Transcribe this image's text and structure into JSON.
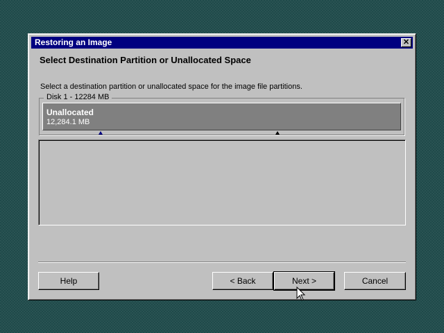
{
  "dialog": {
    "title": "Restoring an Image",
    "close_glyph": "✕",
    "heading": "Select Destination Partition or Unallocated Space",
    "instructions": "Select a destination partition or unallocated space for the image file partitions."
  },
  "disk": {
    "label": "Disk 1 - 12284  MB",
    "partition_name": "Unallocated",
    "partition_size": "12,284.1 MB"
  },
  "buttons": {
    "help": "Help",
    "back": "< Back",
    "next": "Next >",
    "cancel": "Cancel"
  },
  "colors": {
    "titlebar": "#000080",
    "dialog_face": "#c0c0c0",
    "partition_fill": "#808080",
    "desktop": "#1f4a4a"
  },
  "icons": {
    "close": "close-icon",
    "cursor": "mouse-pointer-icon",
    "markers": [
      "partition-start-marker-icon",
      "partition-end-marker-icon"
    ]
  }
}
